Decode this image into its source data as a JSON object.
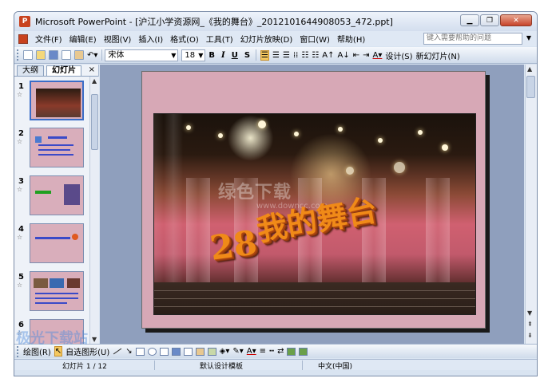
{
  "window": {
    "title": "Microsoft PowerPoint - [沪江小学资源网_《我的舞台》_2012101644908053_472.ppt]",
    "app_icon_letter": "P"
  },
  "menubar": {
    "items": [
      "文件(F)",
      "编辑(E)",
      "视图(V)",
      "插入(I)",
      "格式(O)",
      "工具(T)",
      "幻灯片放映(D)",
      "窗口(W)",
      "帮助(H)"
    ],
    "help_placeholder": "键入需要帮助的问题"
  },
  "toolbar": {
    "font": "宋体",
    "size": "18",
    "bold": "B",
    "italic": "I",
    "underline": "U",
    "shadow": "S",
    "design_label": "设计(S)",
    "new_slide_label": "新幻灯片(N)"
  },
  "panel": {
    "tabs": [
      "大纲",
      "幻灯片"
    ],
    "active_tab": "幻灯片",
    "close": "×",
    "slides": [
      {
        "num": "1",
        "selected": true
      },
      {
        "num": "2",
        "selected": false
      },
      {
        "num": "3",
        "selected": false
      },
      {
        "num": "4",
        "selected": false
      },
      {
        "num": "5",
        "selected": false
      },
      {
        "num": "6",
        "selected": false
      }
    ]
  },
  "slide": {
    "title": "我的舞台",
    "number": "28"
  },
  "watermark": {
    "site": "绿色下载",
    "url": "www.downcc.com",
    "logo": "极光下载站"
  },
  "drawing": {
    "draw_label": "绘图(R)",
    "autoshape_label": "自选图形(U)"
  },
  "status": {
    "slide_info": "幻灯片 1 / 12",
    "template": "默认设计模板",
    "language": "中文(中国)"
  }
}
